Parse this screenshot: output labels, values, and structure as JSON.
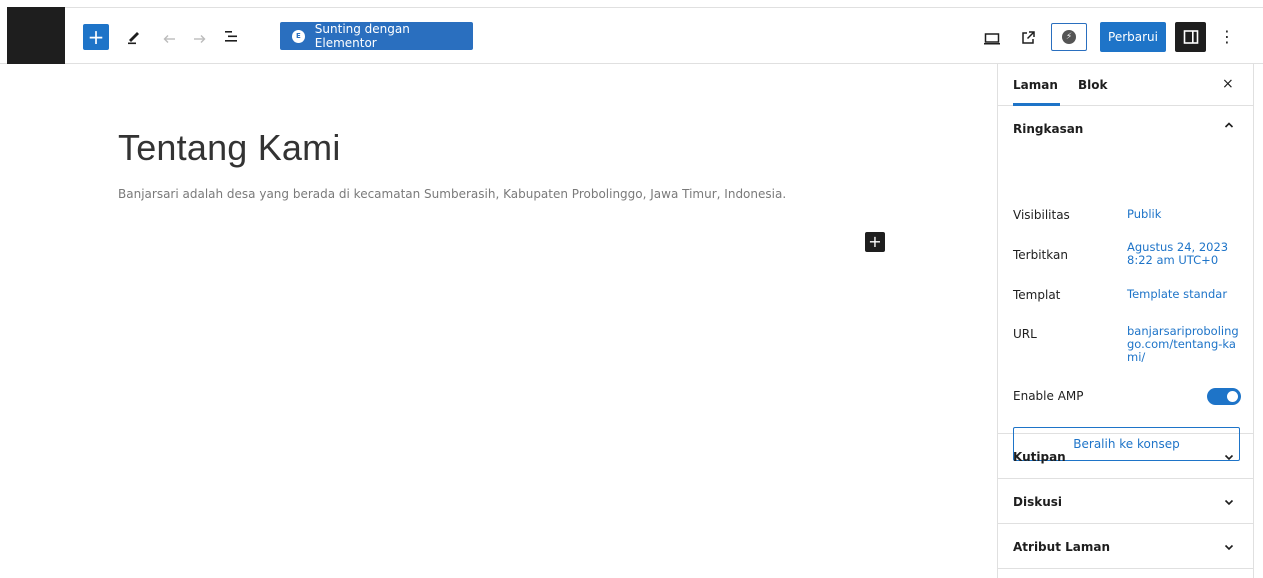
{
  "toolbar": {
    "add_label": "+",
    "elementor_label": "Sunting dengan Elementor",
    "elementor_badge": "E",
    "update_label": "Perbarui",
    "amp_glyph": "⚡",
    "more_glyph": "⋮"
  },
  "content": {
    "title": "Tentang Kami",
    "paragraph": "Banjarsari adalah desa yang berada di kecamatan Sumberasih, Kabupaten Probolinggo, Jawa Timur, Indonesia.",
    "block_add": "+"
  },
  "sidebar": {
    "tabs": [
      {
        "label": "Laman",
        "active": true
      },
      {
        "label": "Blok",
        "active": false
      }
    ],
    "close": "×",
    "summary": {
      "title": "Ringkasan",
      "expanded": true,
      "rows": [
        {
          "label": "Visibilitas",
          "value": "Publik"
        },
        {
          "label": "Terbitkan",
          "value": "Agustus 24, 2023 8:22 am UTC+0"
        },
        {
          "label": "Templat",
          "value": "Template standar"
        },
        {
          "label": "URL",
          "value": "banjarsariprobolinggo.com/tentang-kami/"
        },
        {
          "label": "Enable AMP",
          "value": ""
        }
      ],
      "amp_enabled": true,
      "draft_button": "Beralih ke konsep"
    },
    "panels": [
      {
        "title": "Kutipan",
        "expanded": false
      },
      {
        "title": "Diskusi",
        "expanded": false
      },
      {
        "title": "Atribut Laman",
        "expanded": false
      }
    ]
  },
  "colors": {
    "accent": "#1e74c8",
    "dark": "#1e1e1e",
    "border": "#e0e0e0"
  }
}
